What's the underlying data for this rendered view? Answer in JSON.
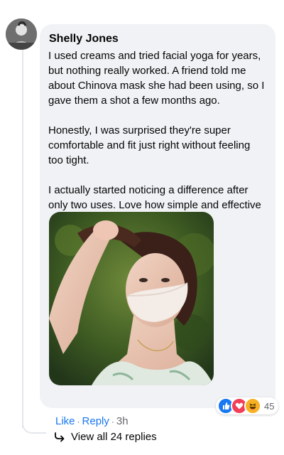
{
  "comment": {
    "author": "Shelly Jones",
    "paragraphs": [
      "I used creams and tried facial yoga for years, but nothing really worked. A friend told me about Chinova mask she had been using, so I gave them a shot a few months ago.",
      "Honestly, I was surprised they're super comfortable and fit just right without feeling too tight.",
      "I actually started noticing a difference after only two uses. Love how simple and effective"
    ],
    "reactions": {
      "icons": [
        "like-icon",
        "love-icon",
        "haha-icon"
      ],
      "count": "45"
    },
    "actions": {
      "like": "Like",
      "reply": "Reply",
      "separator": "·",
      "time": "3h"
    },
    "view_replies": "View all 24 replies"
  },
  "colors": {
    "link": "#1877f2",
    "bubble": "#f0f2f5",
    "secondary_text": "#65676b",
    "like": "#1877f2",
    "love": "#f33e58",
    "haha": "#f7b125"
  }
}
